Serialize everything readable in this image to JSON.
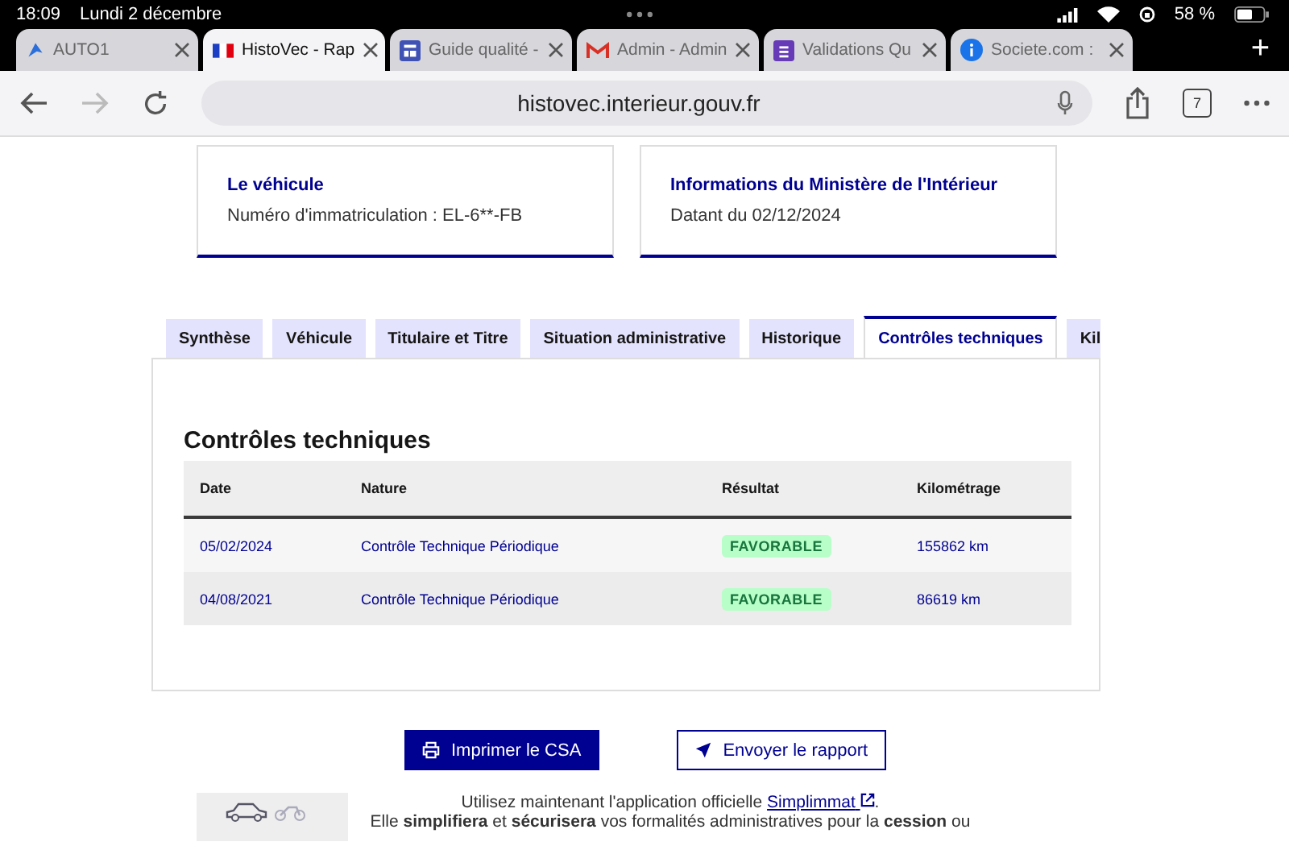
{
  "status_bar": {
    "time": "18:09",
    "date": "Lundi 2 décembre",
    "battery": "58 %"
  },
  "browser_tabs": [
    {
      "label": "AUTO1",
      "selected": false,
      "kind": "arrow"
    },
    {
      "label": "HistoVec - Rap",
      "selected": true,
      "kind": "flag"
    },
    {
      "label": "Guide qualité -",
      "selected": false,
      "kind": "layout"
    },
    {
      "label": "Admin - Admin",
      "selected": false,
      "kind": "mail"
    },
    {
      "label": "Validations Qu",
      "selected": false,
      "kind": "form"
    },
    {
      "label": "Societe.com :",
      "selected": false,
      "kind": "info"
    }
  ],
  "new_tab": "+",
  "address_bar": {
    "url": "histovec.interieur.gouv.fr",
    "tab_count": "7"
  },
  "cards": [
    {
      "title": "Le véhicule",
      "text": "Numéro d'immatriculation : EL-6**-FB"
    },
    {
      "title": "Informations du Ministère de l'Intérieur",
      "text": "Datant du 02/12/2024"
    }
  ],
  "tabs": [
    {
      "label": "Synthèse",
      "selected": false
    },
    {
      "label": "Véhicule",
      "selected": false
    },
    {
      "label": "Titulaire et Titre",
      "selected": false
    },
    {
      "label": "Situation administrative",
      "selected": false
    },
    {
      "label": "Historique",
      "selected": false
    },
    {
      "label": "Contrôles techniques",
      "selected": true
    },
    {
      "label": "Kil",
      "selected": false
    }
  ],
  "section_title": "Contrôles techniques",
  "table": {
    "columns": [
      "Date",
      "Nature",
      "Résultat",
      "Kilométrage"
    ],
    "rows": [
      {
        "date": "05/02/2024",
        "nature": "Contrôle Technique Périodique",
        "result": "FAVORABLE",
        "mileage": "155862 km"
      },
      {
        "date": "04/08/2021",
        "nature": "Contrôle Technique Périodique",
        "result": "FAVORABLE",
        "mileage": "86619 km"
      }
    ]
  },
  "buttons": [
    {
      "label": "Imprimer le CSA",
      "kind": "primary"
    },
    {
      "label": "Envoyer le rapport",
      "kind": "secondary"
    }
  ],
  "footer": {
    "prefix": "Utilisez maintenant l'application officielle ",
    "link": "Simplimmat",
    "suffix": ".",
    "line2": "Elle **simplifiera** et **sécurisera** vos formalités administratives pour la **cession** ou"
  }
}
